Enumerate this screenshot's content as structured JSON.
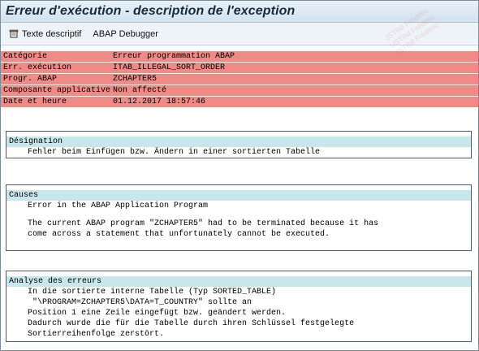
{
  "window": {
    "title": "Erreur d'exécution - description de l'exception"
  },
  "watermark": {
    "lines": [
      "JSTINI Frédéric",
      "USTINI Frédéric",
      "JSTINI Frédéric"
    ]
  },
  "toolbar": {
    "descriptive_text_label": "Texte descriptif",
    "debugger_label": "ABAP Debugger"
  },
  "summary": {
    "rows": [
      {
        "label": "Catégorie",
        "value": "Erreur programmation ABAP"
      },
      {
        "label": "Err. exécution",
        "value": "ITAB_ILLEGAL_SORT_ORDER"
      },
      {
        "label": "Progr. ABAP",
        "value": "ZCHAPTER5"
      },
      {
        "label": "Composante applicative",
        "value": "Non affecté"
      },
      {
        "label": "Date et heure",
        "value": "01.12.2017 18:57:46"
      }
    ]
  },
  "designation": {
    "heading": "Désignation",
    "lines": [
      "Fehler beim Einfügen bzw. Ändern in einer sortierten Tabelle"
    ]
  },
  "causes": {
    "heading": "Causes",
    "line1": "Error in the ABAP Application Program",
    "line2": "The current ABAP program \"ZCHAPTER5\" had to be terminated because it has",
    "line3": "come across a statement that unfortunately cannot be executed."
  },
  "analysis": {
    "heading": "Analyse des erreurs",
    "line1": "In die sortierte interne Tabelle (Typ SORTED_TABLE)",
    "line2": "\"\\PROGRAM=ZCHAPTER5\\DATA=T_COUNTRY\" sollte an",
    "line3": "Position 1 eine Zeile eingefügt bzw. geändert werden.",
    "line4": "Dadurch wurde die für die Tabelle durch ihren Schlüssel festgelegte",
    "line5": "Sortierreihenfolge zerstört."
  },
  "colors": {
    "summary_bg": "#f08a85",
    "panel_header_bg": "#c9e6ea",
    "title_bg": "#dbe7f2"
  }
}
